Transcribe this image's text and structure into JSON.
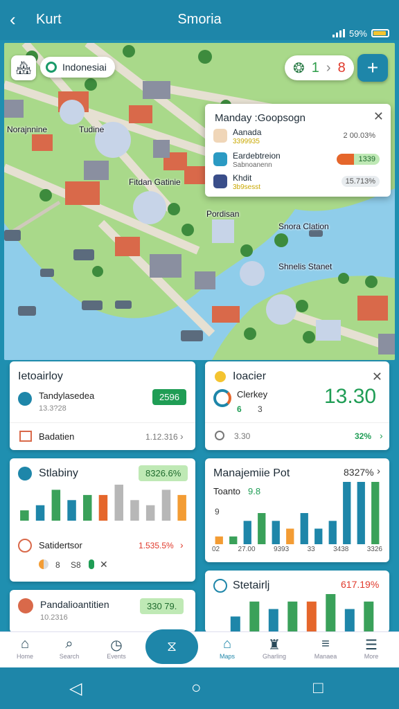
{
  "topbar": {
    "back_label": "Kurt",
    "title": "Smoria",
    "battery": "59%",
    "back_icon": "chevron-left-icon"
  },
  "map": {
    "location_chip": "Indonesiai",
    "score_left": "1",
    "score_right": "8",
    "add_icon": "plus-icon",
    "labels": [
      "Norajnnine",
      "Tudine",
      "Fitdan Gatinie",
      "Pordisan",
      "Snora Clation",
      "Shnelis Stanet"
    ]
  },
  "popup": {
    "title": "Manday :Goopsogn",
    "rows": [
      {
        "name": "Aanada",
        "sub": "3399935",
        "value": "2 00.03%"
      },
      {
        "name": "Eardebtreion",
        "sub": "Sabnoanenn",
        "value": "1339"
      },
      {
        "name": "Khdit",
        "sub": "3b9sesst",
        "value": "15.713%"
      }
    ]
  },
  "cards": {
    "activity": {
      "title": "Ietoairloy",
      "row1_label": "Tandylasedea",
      "row1_sub": "13.3?28",
      "row1_badge": "2596",
      "row2_label": "Badatien",
      "row2_value": "1.12.316"
    },
    "locator": {
      "title": "Ioacier",
      "label": "Clerkey",
      "sub_a": "6",
      "sub_b": "3",
      "big": "13.30",
      "row2_label": "3.30",
      "row2_value": "32%"
    },
    "stability": {
      "title": "Stlabiny",
      "badge": "8326.6%",
      "row_label": "Satidertsor",
      "row_value": "1.535.5%",
      "mini": [
        "8",
        "S8"
      ]
    },
    "manage": {
      "title": "Manajemiie Pot",
      "value": "8327%",
      "sub": "Toanto",
      "sub_value": "9.8",
      "ticks": [
        "02",
        "27.00",
        "9393",
        "33",
        "3438",
        "3326"
      ],
      "yaxis": "9"
    },
    "status": {
      "title": "Stetairlj",
      "value": "617.19%"
    },
    "pending": {
      "title": "Pandalioantitien",
      "sub": "10.2316",
      "badge": "330 79."
    }
  },
  "chart_data": [
    {
      "type": "bar",
      "values": [
        2,
        3,
        6,
        4,
        5,
        5,
        7,
        4,
        3,
        6,
        5
      ],
      "colors": [
        "#3aa15a",
        "#1e86a9",
        "#3aa15a",
        "#1e86a9",
        "#3aa15a",
        "#e5662b",
        "#b7b7b7",
        "#b7b7b7",
        "#b7b7b7",
        "#b7b7b7",
        "#f39c34"
      ]
    },
    {
      "type": "bar",
      "values": [
        1,
        1,
        3,
        4,
        3,
        2,
        4,
        2,
        3,
        8,
        8,
        8
      ],
      "colors": [
        "#f39c34",
        "#3aa15a",
        "#1e86a9",
        "#3aa15a",
        "#1e86a9",
        "#f39c34",
        "#1e86a9",
        "#1e86a9",
        "#1e86a9",
        "#1e86a9",
        "#1e86a9",
        "#3aa15a"
      ]
    },
    {
      "type": "bar",
      "values": [
        2,
        4,
        3,
        4,
        4,
        5,
        3,
        4
      ],
      "colors": [
        "#1e86a9",
        "#3aa15a",
        "#1e86a9",
        "#3aa15a",
        "#e5662b",
        "#3aa15a",
        "#1e86a9",
        "#3aa15a"
      ]
    }
  ],
  "nav": {
    "items": [
      "Home",
      "Search",
      "Events",
      "Maps",
      "Gharling",
      "Manaea",
      "More"
    ],
    "center_icon": "hourglass-icon"
  }
}
